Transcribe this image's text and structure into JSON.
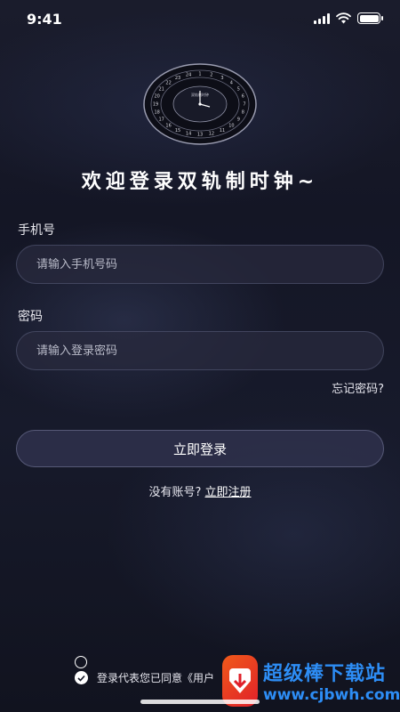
{
  "status_bar": {
    "time": "9:41"
  },
  "logo": {
    "inner_text": "双轨制时钟",
    "ring_numbers": [
      "1",
      "2",
      "3",
      "4",
      "5",
      "6",
      "7",
      "8",
      "9",
      "10",
      "11",
      "12",
      "13",
      "14",
      "15",
      "16",
      "17",
      "18",
      "19",
      "20",
      "21",
      "22",
      "23",
      "24"
    ]
  },
  "welcome_text": "欢迎登录双轨制时钟~",
  "phone": {
    "label": "手机号",
    "placeholder": "请输入手机号码",
    "value": ""
  },
  "password": {
    "label": "密码",
    "placeholder": "请输入登录密码",
    "value": ""
  },
  "forgot_password": "忘记密码?",
  "login_button": "立即登录",
  "register": {
    "prompt": "没有账号?",
    "link": "立即注册"
  },
  "agreement": {
    "text": "登录代表您已同意《用户"
  },
  "watermark": {
    "title": "超级棒下载站",
    "url": "www.cjbwh.com"
  },
  "colors": {
    "background": "#151726",
    "field_bg": "#282a3e",
    "watermark_blue": "#2d8df5",
    "watermark_orange": "#f05a1a"
  }
}
